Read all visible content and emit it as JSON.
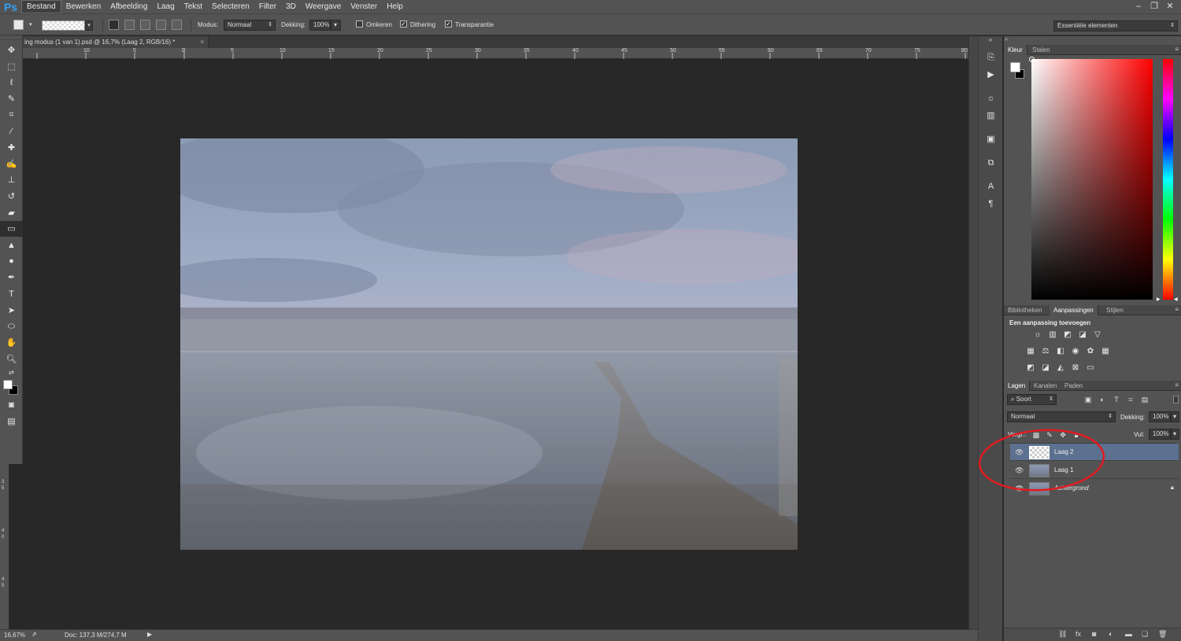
{
  "app": {
    "logo": "Ps"
  },
  "menu": [
    "Bestand",
    "Bewerken",
    "Afbeelding",
    "Laag",
    "Tekst",
    "Selecteren",
    "Filter",
    "3D",
    "Weergave",
    "Venster",
    "Help"
  ],
  "workspace": "Essentiële elementen",
  "options": {
    "mode_label": "Modus:",
    "mode_value": "Normaal",
    "opacity_label": "Dekking:",
    "opacity_value": "100%",
    "reverse_label": "Omkeren",
    "dither_label": "Dithering",
    "transparency_label": "Transparantie"
  },
  "document": {
    "tab_title": "ing modus (1 van 1).psd @ 16,7% (Laag 2, RGB/16) *",
    "close": "×",
    "ruler_ticks": [
      "10",
      "5",
      "0",
      "5",
      "10",
      "15",
      "20",
      "25",
      "30",
      "35",
      "40",
      "45",
      "50",
      "55",
      "60",
      "65",
      "70",
      "75",
      "80"
    ],
    "vruler_ticks": [
      "3",
      "5",
      "4",
      "0",
      "4",
      "5"
    ]
  },
  "status": {
    "zoom": "16,67%",
    "doc": "Doc: 137,3 M/274,7 M"
  },
  "panels": {
    "color_tabs": [
      "Kleur",
      "Stalen"
    ],
    "adjust_tabs": [
      "Bibliotheken",
      "Aanpassingen",
      "Stijlen"
    ],
    "adjust_heading": "Een aanpassing toevoegen",
    "layer_tabs": [
      "Lagen",
      "Kanalen",
      "Paden"
    ],
    "filter_kind": "Soort",
    "blend_mode": "Normaal",
    "opacity_label": "Dekking:",
    "opacity_value": "100%",
    "lock_label": "Vergr.:",
    "fill_label": "Vul:",
    "fill_value": "100%",
    "layers": [
      {
        "name": "Laag 2",
        "selected": true
      },
      {
        "name": "Laag 1",
        "selected": false
      },
      {
        "name": "Achtergrond",
        "selected": false,
        "locked": true
      }
    ]
  },
  "colors": {
    "accent": "#2fa3f0",
    "selection": "#5c708f",
    "annotation": "#e21b22"
  }
}
